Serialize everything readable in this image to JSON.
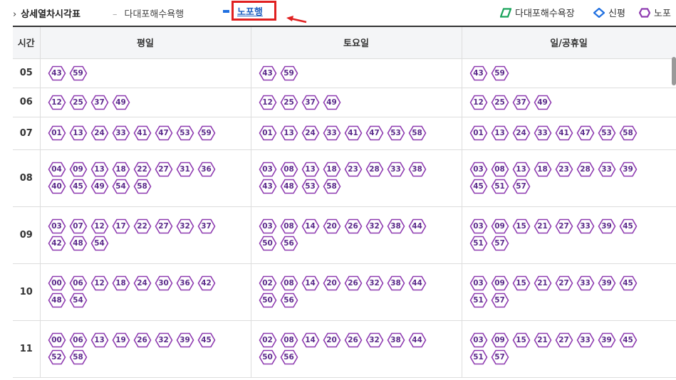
{
  "header": {
    "chevron": "›",
    "title": "상세열차시각표",
    "dash": "–",
    "direction_1": "다대포해수욕행",
    "direction_2": "노포행"
  },
  "legend": [
    {
      "label": "다대포해수욕장",
      "shape": "parallelogram-icon",
      "color": "#19a35a"
    },
    {
      "label": "신평",
      "shape": "diamond-icon",
      "color": "#1f6fe0"
    },
    {
      "label": "노포",
      "shape": "hexagon-icon",
      "color": "#8e3ab0"
    }
  ],
  "table": {
    "headers": [
      "시간",
      "평일",
      "토요일",
      "일/공휴일"
    ],
    "rows": [
      {
        "hour": "05",
        "weekday": [
          "43",
          "59"
        ],
        "saturday": [
          "43",
          "59"
        ],
        "holiday": [
          "43",
          "59"
        ]
      },
      {
        "hour": "06",
        "weekday": [
          "12",
          "25",
          "37",
          "49"
        ],
        "saturday": [
          "12",
          "25",
          "37",
          "49"
        ],
        "holiday": [
          "12",
          "25",
          "37",
          "49"
        ]
      },
      {
        "hour": "07",
        "weekday": [
          "01",
          "13",
          "24",
          "33",
          "41",
          "47",
          "53",
          "59"
        ],
        "saturday": [
          "01",
          "13",
          "24",
          "33",
          "41",
          "47",
          "53",
          "58"
        ],
        "holiday": [
          "01",
          "13",
          "24",
          "33",
          "41",
          "47",
          "53",
          "58"
        ]
      },
      {
        "hour": "08",
        "weekday": [
          "04",
          "09",
          "13",
          "18",
          "22",
          "27",
          "31",
          "36",
          "40",
          "45",
          "49",
          "54",
          "58"
        ],
        "saturday": [
          "03",
          "08",
          "13",
          "18",
          "23",
          "28",
          "33",
          "38",
          "43",
          "48",
          "53",
          "58"
        ],
        "holiday": [
          "03",
          "08",
          "13",
          "18",
          "23",
          "28",
          "33",
          "39",
          "45",
          "51",
          "57"
        ]
      },
      {
        "hour": "09",
        "weekday": [
          "03",
          "07",
          "12",
          "17",
          "22",
          "27",
          "32",
          "37",
          "42",
          "48",
          "54"
        ],
        "saturday": [
          "03",
          "08",
          "14",
          "20",
          "26",
          "32",
          "38",
          "44",
          "50",
          "56"
        ],
        "holiday": [
          "03",
          "09",
          "15",
          "21",
          "27",
          "33",
          "39",
          "45",
          "51",
          "57"
        ]
      },
      {
        "hour": "10",
        "weekday": [
          "00",
          "06",
          "12",
          "18",
          "24",
          "30",
          "36",
          "42",
          "48",
          "54"
        ],
        "saturday": [
          "02",
          "08",
          "14",
          "20",
          "26",
          "32",
          "38",
          "44",
          "50",
          "56"
        ],
        "holiday": [
          "03",
          "09",
          "15",
          "21",
          "27",
          "33",
          "39",
          "45",
          "51",
          "57"
        ]
      },
      {
        "hour": "11",
        "weekday": [
          "00",
          "06",
          "13",
          "19",
          "26",
          "32",
          "39",
          "45",
          "52",
          "58"
        ],
        "saturday": [
          "02",
          "08",
          "14",
          "20",
          "26",
          "32",
          "38",
          "44",
          "50",
          "56"
        ],
        "holiday": [
          "03",
          "09",
          "15",
          "21",
          "27",
          "33",
          "39",
          "45",
          "51",
          "57"
        ]
      }
    ]
  },
  "colors": {
    "hex_stroke": "#8e3ab0",
    "highlight_box": "#e02020",
    "arrow": "#e02020"
  }
}
